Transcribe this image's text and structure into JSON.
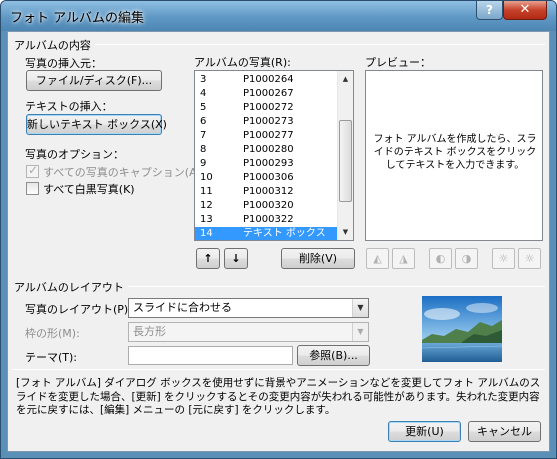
{
  "window": {
    "title": "フォト アルバムの編集",
    "help_label": "?",
    "close_label": "✕"
  },
  "content_group": {
    "title": "アルバムの内容",
    "insert_picture_label": "写真の挿入元：",
    "file_disk_button": "ファイル/ディスク(F)...",
    "insert_text_label": "テキストの挿入：",
    "new_textbox_button": "新しいテキスト ボックス(X)",
    "picture_options_label": "写真のオプション：",
    "captions_option": "すべての写真のキャプション(A)",
    "bw_option": "すべて白黒写真(K)"
  },
  "picture_list": {
    "label": "アルバムの写真(R):",
    "items": [
      {
        "num": "3",
        "name": "P1000264"
      },
      {
        "num": "4",
        "name": "P1000267"
      },
      {
        "num": "5",
        "name": "P1000272"
      },
      {
        "num": "6",
        "name": "P1000273"
      },
      {
        "num": "7",
        "name": "P1000277"
      },
      {
        "num": "8",
        "name": "P1000280"
      },
      {
        "num": "9",
        "name": "P1000293"
      },
      {
        "num": "10",
        "name": "P1000306"
      },
      {
        "num": "11",
        "name": "P1000312"
      },
      {
        "num": "12",
        "name": "P1000320"
      },
      {
        "num": "13",
        "name": "P1000322"
      },
      {
        "num": "14",
        "name": "テキスト ボックス"
      }
    ],
    "selected_index": 11,
    "up_label": "↑",
    "down_label": "↓",
    "delete_button": "削除(V)"
  },
  "preview": {
    "label": "プレビュー：",
    "text": "フォト アルバムを作成したら、スライドのテキスト ボックスをクリックしてテキストを入力できます。"
  },
  "tools": [
    {
      "icon": "rotate-left-icon",
      "glyph": "◭"
    },
    {
      "icon": "rotate-right-icon",
      "glyph": "◮"
    },
    {
      "icon": "contrast-up-icon",
      "glyph": "◐"
    },
    {
      "icon": "contrast-down-icon",
      "glyph": "◑"
    },
    {
      "icon": "brightness-up-icon",
      "glyph": "☼"
    },
    {
      "icon": "brightness-down-icon",
      "glyph": "☼"
    }
  ],
  "layout_group": {
    "title": "アルバムのレイアウト",
    "picture_layout_label": "写真のレイアウト(P):",
    "picture_layout_value": "スライドに合わせる",
    "frame_shape_label": "枠の形(M):",
    "frame_shape_value": "長方形",
    "theme_label": "テーマ(T):",
    "theme_value": "",
    "browse_button": "参照(B)..."
  },
  "note": "[フォト アルバム] ダイアログ ボックスを使用せずに背景やアニメーションなどを変更してフォト アルバムのスライドを変更した場合、[更新] をクリックするとその変更内容が失われる可能性があります。失われた変更内容を元に戻すには、[編集] メニューの [元に戻す] をクリックします。",
  "footer": {
    "update_button": "更新(U)",
    "cancel_button": "キャンセル"
  }
}
